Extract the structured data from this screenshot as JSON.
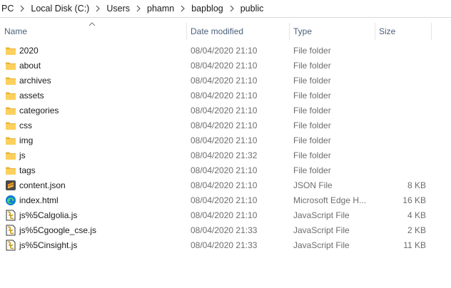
{
  "breadcrumb": [
    "PC",
    "Local Disk (C:)",
    "Users",
    "phamn",
    "bapblog",
    "public"
  ],
  "columns": {
    "name": "Name",
    "date": "Date modified",
    "type": "Type",
    "size": "Size"
  },
  "files": [
    {
      "name": "2020",
      "date": "08/04/2020 21:10",
      "type": "File folder",
      "size": "",
      "icon": "folder-icon"
    },
    {
      "name": "about",
      "date": "08/04/2020 21:10",
      "type": "File folder",
      "size": "",
      "icon": "folder-icon"
    },
    {
      "name": "archives",
      "date": "08/04/2020 21:10",
      "type": "File folder",
      "size": "",
      "icon": "folder-icon"
    },
    {
      "name": "assets",
      "date": "08/04/2020 21:10",
      "type": "File folder",
      "size": "",
      "icon": "folder-icon"
    },
    {
      "name": "categories",
      "date": "08/04/2020 21:10",
      "type": "File folder",
      "size": "",
      "icon": "folder-icon"
    },
    {
      "name": "css",
      "date": "08/04/2020 21:10",
      "type": "File folder",
      "size": "",
      "icon": "folder-icon"
    },
    {
      "name": "img",
      "date": "08/04/2020 21:10",
      "type": "File folder",
      "size": "",
      "icon": "folder-icon"
    },
    {
      "name": "js",
      "date": "08/04/2020 21:32",
      "type": "File folder",
      "size": "",
      "icon": "folder-icon"
    },
    {
      "name": "tags",
      "date": "08/04/2020 21:10",
      "type": "File folder",
      "size": "",
      "icon": "folder-icon"
    },
    {
      "name": "content.json",
      "date": "08/04/2020 21:10",
      "type": "JSON File",
      "size": "8 KB",
      "icon": "sublime-text-icon"
    },
    {
      "name": "index.html",
      "date": "08/04/2020 21:10",
      "type": "Microsoft Edge H...",
      "size": "16 KB",
      "icon": "edge-icon"
    },
    {
      "name": "js%5Calgolia.js",
      "date": "08/04/2020 21:10",
      "type": "JavaScript File",
      "size": "4 KB",
      "icon": "script-file-icon"
    },
    {
      "name": "js%5Cgoogle_cse.js",
      "date": "08/04/2020 21:33",
      "type": "JavaScript File",
      "size": "2 KB",
      "icon": "script-file-icon"
    },
    {
      "name": "js%5Cinsight.js",
      "date": "08/04/2020 21:33",
      "type": "JavaScript File",
      "size": "11 KB",
      "icon": "script-file-icon"
    }
  ]
}
